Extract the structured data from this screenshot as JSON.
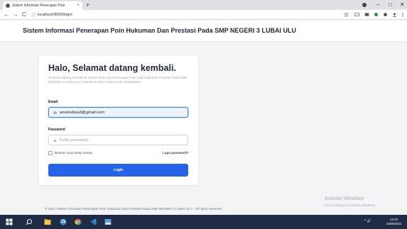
{
  "browser": {
    "tab_title": "Sistem Informasi Penerapan Poin",
    "tab_close": "×",
    "new_tab": "+",
    "url": "localhost:8000/login",
    "info_icon": "ⓘ",
    "back": "←",
    "forward": "→",
    "reload": "C",
    "minimize": "–",
    "maximize": "□",
    "close": "✕",
    "icons": [
      "star-icon",
      "tab-search-icon",
      "extensions-icon",
      "profile-icon",
      "menu-icon"
    ]
  },
  "header": {
    "title": "Sistem Informasi Penerapan Poin Hukuman Dan Prestasi Pada SMP NEGERI 3 LUBAI ULU"
  },
  "login": {
    "greeting": "Halo, Selamat datang kembali.",
    "subtext": "Selamat datang kembali di Sistem Informasi Penerapan Poin Hukuman Dan Prestasi Pada SMP NEGERI 3 LUBAI ULU. Masuk ke akun Anda untuk melanjutkan.",
    "email_label": "Email",
    "email_value": "anamelisia3@gmail.com",
    "password_label": "Password",
    "password_placeholder": "Ketik password...",
    "remember_label": "Biarkan saya tetap masuk",
    "forgot_label": "Lupa password?",
    "submit_label": "Login"
  },
  "footer": {
    "copyright": "© 2021 Sistem Informasi Penerapan Poin Hukuman Dan Prestasi Pada SMP NEGERI 3 LUBAI ULU . All rights reserved"
  },
  "watermark": {
    "title": "Activate Windows",
    "subtitle": "Go to Settings to activate Windows."
  },
  "taskbar": {
    "tray_text": "^ 🔊",
    "time": "12:41",
    "date": "20/06/2021"
  },
  "colors": {
    "accent": "#2563eb",
    "taskbar": "#1f2a44",
    "page_bg": "#f3f4f6"
  }
}
